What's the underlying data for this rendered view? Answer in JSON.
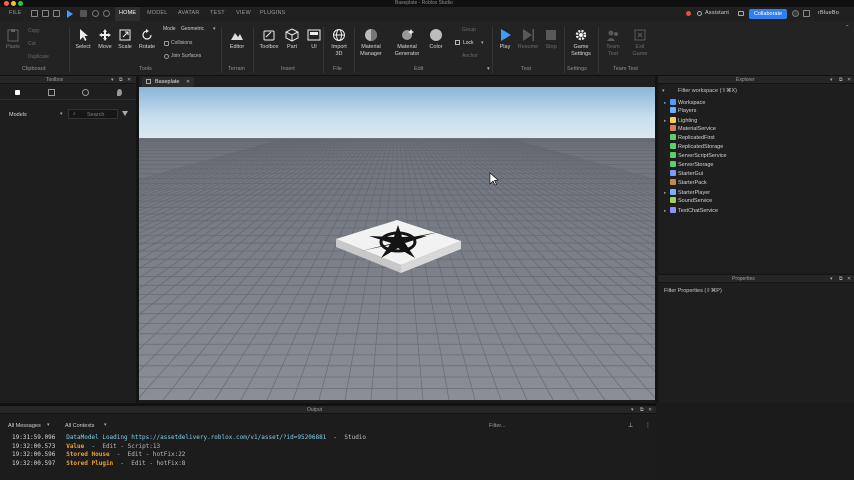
{
  "window": {
    "title": "Baseplate - Roblox Studio"
  },
  "menu": {
    "file": "FILE",
    "tabs": [
      "HOME",
      "MODEL",
      "AVATAR",
      "TEST",
      "VIEW",
      "PLUGINS"
    ],
    "assistant": "Assistant",
    "collaborate": "Collaborate",
    "user": "rBlueBo"
  },
  "ribbon": {
    "clipboard": {
      "paste": "Paste",
      "copy": "Copy",
      "cut": "Cut",
      "duplicate": "Duplicate",
      "group": "Clipboard"
    },
    "tools": {
      "select": "Select",
      "move": "Move",
      "scale": "Scale",
      "rotate": "Rotate",
      "group": "Tools"
    },
    "mode": {
      "label": "Mode",
      "value": "Geometric",
      "collisions": "Collisions",
      "join": "Join Surfaces"
    },
    "terrain": {
      "editor": "Editor",
      "group": "Terrain"
    },
    "insert": {
      "toolbox": "Toolbox",
      "part": "Part",
      "ui": "UI",
      "group": "Insert"
    },
    "file": {
      "import": "Import\n3D",
      "group": "File"
    },
    "edit": {
      "material_manager": "Material\nManager",
      "material_generator": "Material\nGenerator",
      "color": "Color",
      "group": "Edit",
      "group_label": "Group",
      "lock": "Lock",
      "anchor": "Anchor"
    },
    "test": {
      "play": "Play",
      "resume": "Resume",
      "stop": "Stop",
      "group": "Test"
    },
    "settings": {
      "game_settings": "Game\nSettings",
      "group": "Settings"
    },
    "team_test": {
      "team_test": "Team\nTest",
      "exit_game": "Exit\nGame",
      "group": "Team Test"
    }
  },
  "toolbox": {
    "title": "Toolbox",
    "category": "Models",
    "search_placeholder": "Search"
  },
  "viewport_tab": {
    "label": "Baseplate"
  },
  "explorer": {
    "title": "Explorer",
    "filter_placeholder": "Filter workspace (⇧⌘X)",
    "items": [
      {
        "name": "Workspace",
        "expandable": true,
        "color": "#4aa0ff"
      },
      {
        "name": "Players",
        "expandable": false,
        "color": "#6cb0ff"
      },
      {
        "name": "Lighting",
        "expandable": true,
        "color": "#f5d24a"
      },
      {
        "name": "MaterialService",
        "expandable": false,
        "color": "#e07a5f"
      },
      {
        "name": "ReplicatedFirst",
        "expandable": false,
        "color": "#5bd06a"
      },
      {
        "name": "ReplicatedStorage",
        "expandable": false,
        "color": "#5bd06a"
      },
      {
        "name": "ServerScriptService",
        "expandable": false,
        "color": "#5bd06a"
      },
      {
        "name": "ServerStorage",
        "expandable": false,
        "color": "#5bd06a"
      },
      {
        "name": "StarterGui",
        "expandable": false,
        "color": "#7a9cff"
      },
      {
        "name": "StarterPack",
        "expandable": false,
        "color": "#c08a4a"
      },
      {
        "name": "StarterPlayer",
        "expandable": true,
        "color": "#7ab0ff"
      },
      {
        "name": "SoundService",
        "expandable": false,
        "color": "#9ed05a"
      },
      {
        "name": "TextChatService",
        "expandable": true,
        "color": "#8f8fff"
      }
    ]
  },
  "properties": {
    "title": "Properties",
    "filter_placeholder": "Filter Properties (⇧⌘P)"
  },
  "output": {
    "title": "Output",
    "messages_filter": "All Messages",
    "contexts_filter": "All Contexts",
    "filter_placeholder": "Filter...",
    "lines": [
      {
        "time": "19:31:59.096",
        "prefix": "DataModel Loading https://assetdelivery.roblox.com/v1/asset/?id=95206881",
        "suffix": "  -  Studio",
        "color": "#7fd1e8"
      },
      {
        "time": "19:32:00.573",
        "prefix": "Value",
        "suffix": "  -  Edit - Script:13",
        "color": "#f0a030"
      },
      {
        "time": "19:32:00.596",
        "prefix": "Stored House",
        "suffix": "  -  Edit - hotFix:22",
        "color": "#f0a030"
      },
      {
        "time": "19:32:00.597",
        "prefix": "Stored Plugin",
        "suffix": "  -  Edit - hotFix:8",
        "color": "#f0a030"
      }
    ]
  }
}
